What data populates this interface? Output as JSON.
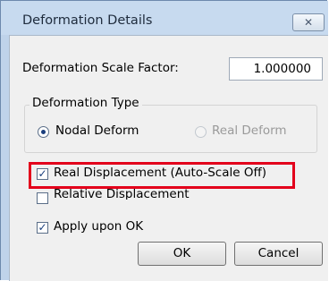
{
  "window": {
    "title": "Deformation Details",
    "close_glyph": "✕"
  },
  "scale_factor": {
    "label": "Deformation Scale Factor:",
    "value": "1.000000"
  },
  "deformation_type": {
    "group_label": "Deformation Type",
    "options": [
      {
        "label": "Nodal Deform",
        "selected": true,
        "enabled": true
      },
      {
        "label": "Real Deform",
        "selected": false,
        "enabled": false
      }
    ]
  },
  "checkboxes": {
    "real_displacement": {
      "label": "Real Displacement (Auto-Scale Off)",
      "checked": true
    },
    "relative_displacement": {
      "label": "Relative Displacement",
      "checked": false
    },
    "apply_upon_ok": {
      "label": "Apply upon OK",
      "checked": true
    }
  },
  "buttons": {
    "ok": "OK",
    "cancel": "Cancel"
  },
  "check_glyph": "✓",
  "colors": {
    "highlight": "#e3001b",
    "frame": "#bfd3ea"
  }
}
